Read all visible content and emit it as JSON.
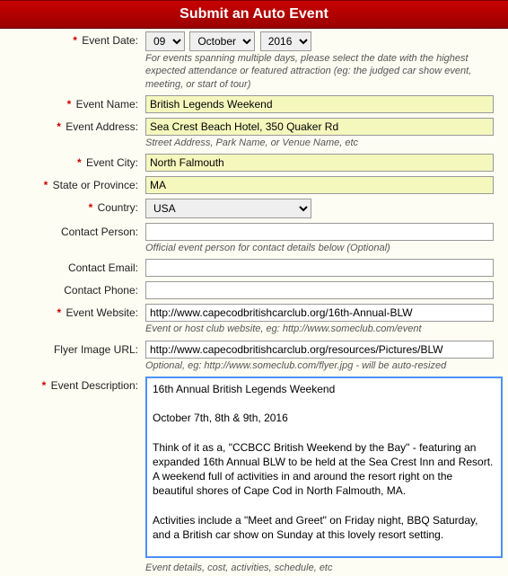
{
  "header": {
    "title": "Submit an Auto Event"
  },
  "labels": {
    "eventDate": "Event Date:",
    "eventName": "Event Name:",
    "eventAddress": "Event Address:",
    "eventCity": "Event City:",
    "stateProvince": "State or Province:",
    "country": "Country:",
    "contactPerson": "Contact Person:",
    "contactEmail": "Contact Email:",
    "contactPhone": "Contact Phone:",
    "eventWebsite": "Event Website:",
    "flyerUrl": "Flyer Image URL:",
    "eventDescription": "Event Description:"
  },
  "values": {
    "day": "09",
    "month": "October",
    "year": "2016",
    "eventName": "British Legends Weekend",
    "eventAddress": "Sea Crest Beach Hotel, 350 Quaker Rd",
    "eventCity": "North Falmouth",
    "stateProvince": "MA",
    "country": "USA",
    "contactPerson": "",
    "contactEmail": "",
    "contactPhone": "",
    "eventWebsite": "http://www.capecodbritishcarclub.org/16th-Annual-BLW",
    "flyerUrl": "http://www.capecodbritishcarclub.org/resources/Pictures/BLW",
    "eventDescription": "16th Annual British Legends Weekend\n\nOctober 7th, 8th & 9th, 2016\n\nThink of it as a, \"CCBCC British Weekend by the Bay\" - featuring an expanded 16th Annual BLW to be held at the Sea Crest Inn and Resort. A weekend full of activities in and around the resort right on the beautiful shores of Cape Cod in North Falmouth, MA.\n\nActivities include a \"Meet and Greet\" on Friday night, BBQ Saturday, and a British car show on Sunday at this lovely resort setting.\n\nSee the Cape Cod British Car Club website for a full description of the weekend's events and information on registering to be a participant in this PREMIER LBC event."
  },
  "hints": {
    "date": "For events spanning multiple days, please select the date with the highest expected attendance or featured attraction (eg: the judged car show event, meeting, or start of tour)",
    "address": "Street Address, Park Name, or Venue Name, etc",
    "contactPerson": "Official event person for contact details below (Optional)",
    "website": "Event or host club website, eg: http://www.someclub.com/event",
    "flyer": "Optional, eg: http://www.someclub.com/flyer.jpg - will be auto-resized",
    "description": "Event details, cost, activities, schedule, etc"
  },
  "required_marker": "*"
}
